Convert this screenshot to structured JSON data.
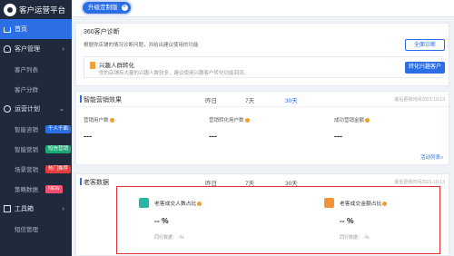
{
  "app": {
    "title": "客户运营平台"
  },
  "topbar": {
    "upgrade_label": "升级定制版",
    "upgrade_close": "×"
  },
  "sidebar": {
    "home": "首页",
    "group_customer": "客户管理",
    "customer_list": "客户列表",
    "customer_segment": "客户分群",
    "group_ops": "运营计划",
    "smart_catch": "智能咨销",
    "smart_catch_tag": "千人千面",
    "smart_marketing": "智能营销",
    "smart_marketing_tag": "短信营销",
    "scene_marketing": "场景营销",
    "scene_marketing_tag": "热门推荐",
    "strategy_data": "策略数据",
    "strategy_data_tag": "NEW",
    "group_tools": "工具箱",
    "sms_manage": "短信管理",
    "chevron": "›",
    "chevron_down": "⌄"
  },
  "panel_diagnosis": {
    "title": "360客户诊断",
    "desc": "根据你店铺的情况诊断问题，并给出建议使用的功能",
    "scan_btn": "全面诊断",
    "card_title": "兴趣人群转化",
    "card_desc": "你的店铺有大量的兴趣人数较多，建议使用兴趣客户转化功能回流。",
    "card_btn": "转化兴趣客户"
  },
  "panel_marketing": {
    "title": "智能营销效果",
    "period_yesterday": "昨日",
    "period_7": "7天",
    "period_30": "30天",
    "update": "最后更新时间2021-10-13",
    "metrics": [
      {
        "label": "营销用户数",
        "value": "---"
      },
      {
        "label": "营销转化用户数",
        "value": "---"
      },
      {
        "label": "成功营销金额",
        "value": "---"
      }
    ],
    "more": "活动列表»"
  },
  "panel_old": {
    "title": "老客数据",
    "period_yesterday": "昨日",
    "period_7": "7天",
    "period_30": "30天",
    "update": "最后更新时间2021-10-13",
    "cards": [
      {
        "title": "老客成交人数占比",
        "value": "-- %",
        "peer_label": "同行数据：",
        "peer_value": "-%"
      },
      {
        "title": "老客成交金额占比",
        "value": "-- %",
        "peer_label": "同行数据：",
        "peer_value": "-%"
      }
    ]
  },
  "colors": {
    "accent": "#2c6ee6",
    "sidebar_bg": "#1f2a3c",
    "highlight": "#e0302f"
  }
}
